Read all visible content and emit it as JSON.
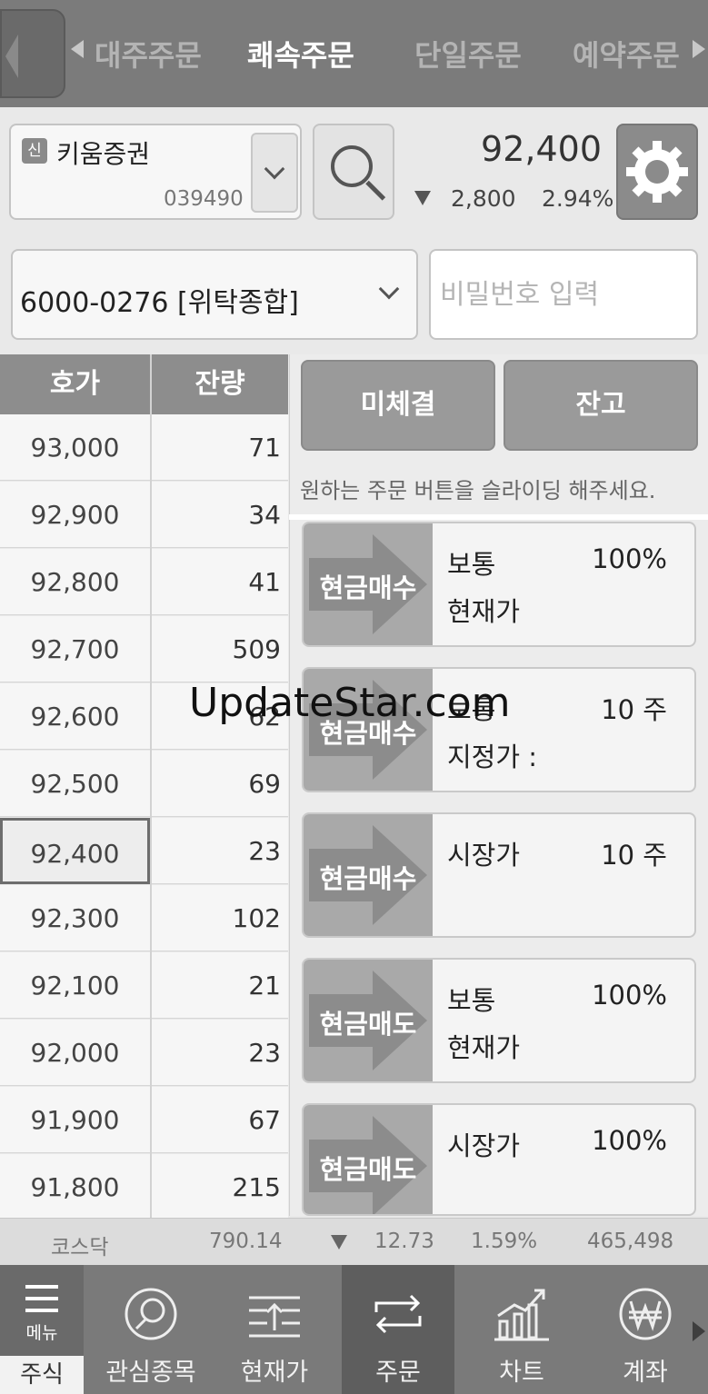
{
  "tabs": [
    {
      "label": "대주주문",
      "active": false
    },
    {
      "label": "쾌속주문",
      "active": true
    },
    {
      "label": "단일주문",
      "active": false
    },
    {
      "label": "예약주문",
      "active": false
    }
  ],
  "stock": {
    "credit_badge": "신",
    "name": "키움증권",
    "code": "039490",
    "price": "92,400",
    "change": "2,800",
    "change_rate": "2.94%"
  },
  "account": {
    "number": "6000-0276 [위탁종합]",
    "password_placeholder": "비밀번호 입력"
  },
  "orderbook": {
    "headers": {
      "price": "호가",
      "qty": "잔량"
    },
    "rows": [
      {
        "price": "93,000",
        "qty": "71"
      },
      {
        "price": "92,900",
        "qty": "34"
      },
      {
        "price": "92,800",
        "qty": "41"
      },
      {
        "price": "92,700",
        "qty": "509"
      },
      {
        "price": "92,600",
        "qty": "62"
      },
      {
        "price": "92,500",
        "qty": "69"
      },
      {
        "price": "92,400",
        "qty": "23",
        "current": true
      },
      {
        "price": "92,300",
        "qty": "102"
      },
      {
        "price": "92,100",
        "qty": "21"
      },
      {
        "price": "92,000",
        "qty": "23"
      },
      {
        "price": "91,900",
        "qty": "67"
      },
      {
        "price": "91,800",
        "qty": "215"
      }
    ]
  },
  "panel": {
    "unfilled_label": "미체결",
    "balance_label": "잔고",
    "hint": "원하는 주문 버튼을 슬라이딩 해주세요."
  },
  "order_cards": [
    {
      "action": "현금매수",
      "line1": "보통",
      "line2": "현재가",
      "value": "100%"
    },
    {
      "action": "현금매수",
      "line1": "보통",
      "line2": "지정가 :",
      "value": "10 주"
    },
    {
      "action": "현금매수",
      "line1": "시장가",
      "line2": "",
      "value": "10 주"
    },
    {
      "action": "현금매도",
      "line1": "보통",
      "line2": "현재가",
      "value": "100%"
    },
    {
      "action": "현금매도",
      "line1": "시장가",
      "line2": "",
      "value": "100%"
    }
  ],
  "market": {
    "name": "코스닥",
    "index": "790.14",
    "change": "12.73",
    "rate": "1.59%",
    "volume": "465,498"
  },
  "nav": {
    "menu_label": "메뉴",
    "stock_tab": "주식",
    "items": [
      {
        "label": "관심종목",
        "icon": "watchlist-icon"
      },
      {
        "label": "현재가",
        "icon": "current-price-icon"
      },
      {
        "label": "주문",
        "icon": "order-icon",
        "active": true
      },
      {
        "label": "차트",
        "icon": "chart-icon"
      },
      {
        "label": "계좌",
        "icon": "account-won-icon"
      }
    ]
  },
  "watermark": "UpdateStar.com",
  "colors": {
    "tab_bar": "#7b7b7b",
    "header_gray": "#8d8d8d",
    "panel_bg": "#ececec"
  }
}
